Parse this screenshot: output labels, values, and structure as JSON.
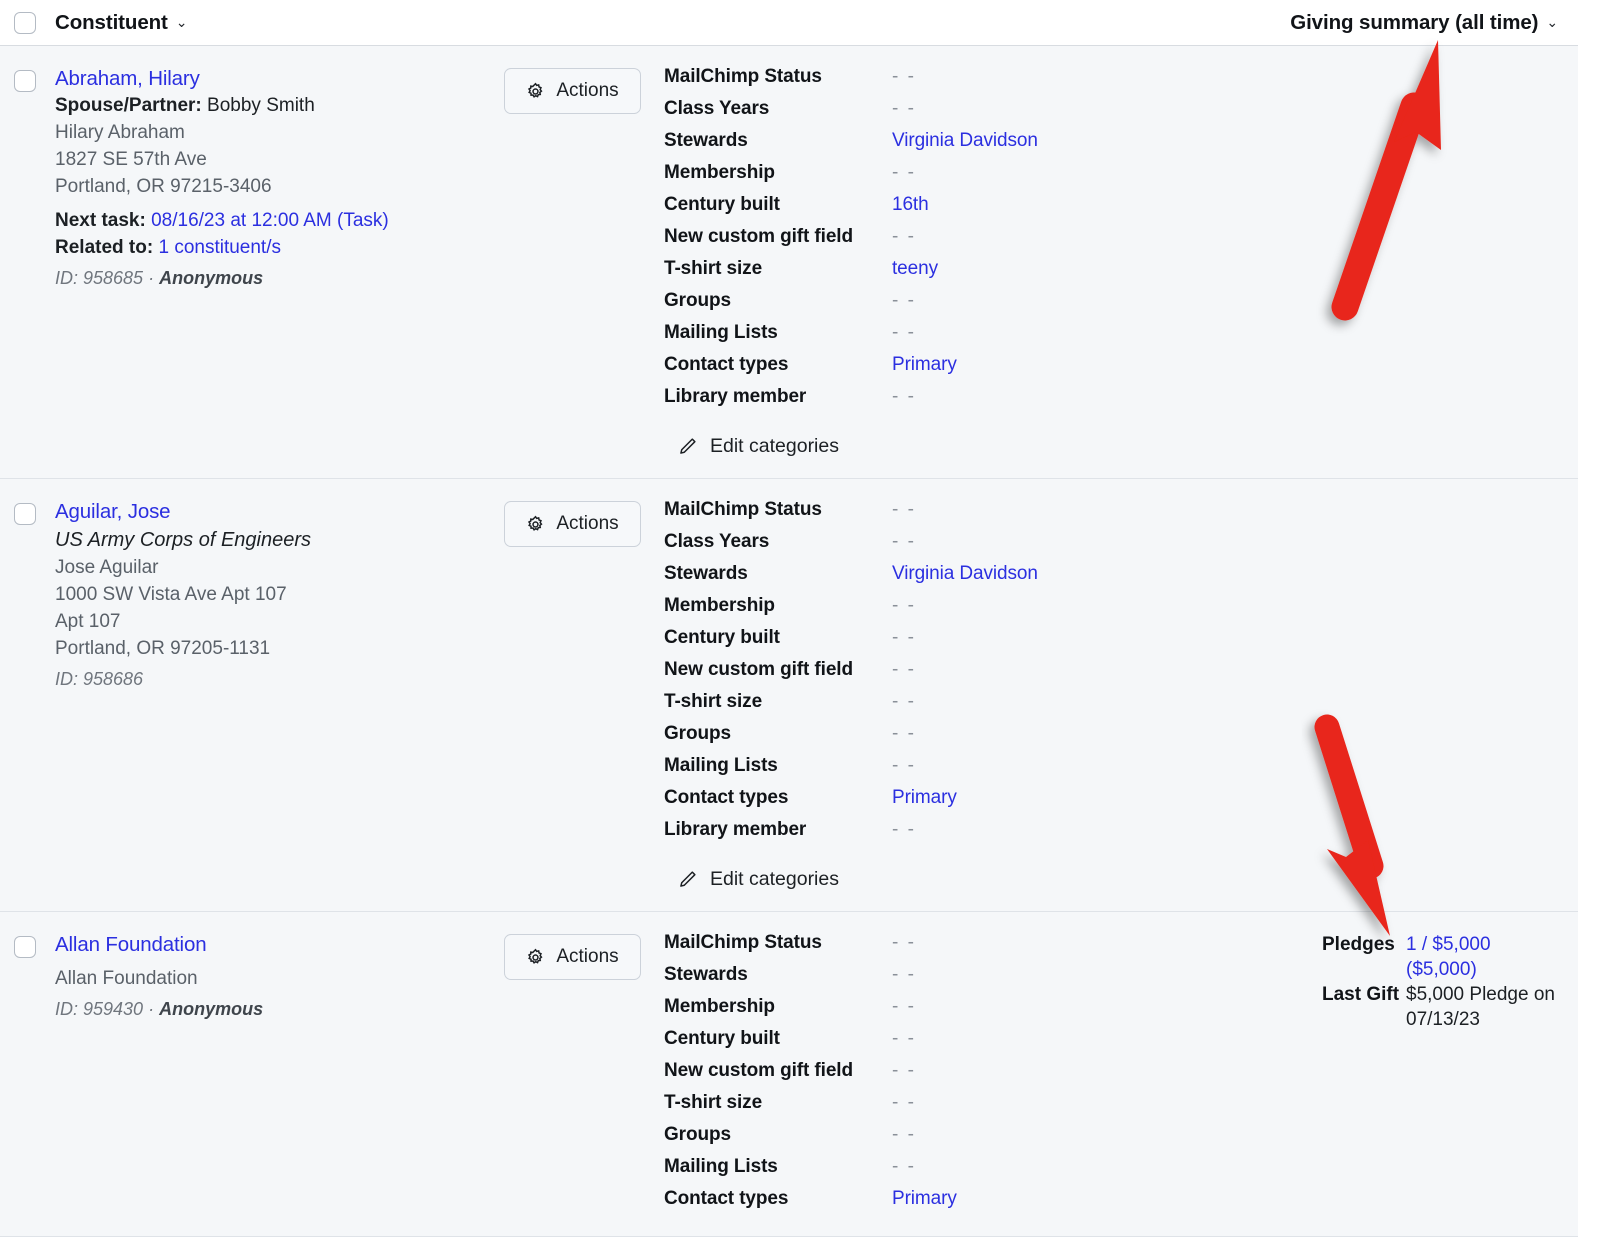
{
  "header": {
    "title": "Constituent",
    "caret_icon": "chevron-down-icon",
    "giving_summary_label": "Giving summary (all time)",
    "giving_summary_caret_icon": "chevron-down-icon"
  },
  "common": {
    "actions_label": "Actions",
    "actions_icon": "gear-icon",
    "edit_categories_label": "Edit categories",
    "edit_categories_icon": "pencil-icon",
    "empty_value": "- -",
    "checkbox_icon": "checkbox-unchecked-icon"
  },
  "colors": {
    "link": "#2b2fe0",
    "text": "#1c2024",
    "muted": "#70767e",
    "row_background": "#f5f7f9",
    "annotation_red": "#e8261a"
  },
  "rows": [
    {
      "name": "Abraham, Hilary",
      "org": "",
      "spouse_label": "Spouse/Partner:",
      "spouse_value": "Bobby Smith",
      "address": [
        "Hilary Abraham",
        "1827 SE 57th Ave",
        "Portland, OR 97215-3406"
      ],
      "next_task_label": "Next task:",
      "next_task_value": "08/16/23 at 12:00 AM (Task)",
      "related_to_label": "Related to:",
      "related_to_value": "1 constituent/s",
      "id_text": "ID: 958685 ·",
      "anonymous": "Anonymous",
      "fields": [
        {
          "label": "MailChimp Status",
          "value": "- -",
          "empty": true
        },
        {
          "label": "Class Years",
          "value": "- -",
          "empty": true
        },
        {
          "label": "Stewards",
          "value": "Virginia Davidson",
          "empty": false
        },
        {
          "label": "Membership",
          "value": "- -",
          "empty": true
        },
        {
          "label": "Century built",
          "value": "16th",
          "empty": false
        },
        {
          "label": "New custom gift field",
          "value": "- -",
          "empty": true
        },
        {
          "label": "T-shirt size",
          "value": "teeny",
          "empty": false
        },
        {
          "label": "Groups",
          "value": "- -",
          "empty": true
        },
        {
          "label": "Mailing Lists",
          "value": "- -",
          "empty": true
        },
        {
          "label": "Contact types",
          "value": "Primary",
          "empty": false
        },
        {
          "label": "Library member",
          "value": "- -",
          "empty": true
        }
      ],
      "giving": []
    },
    {
      "name": "Aguilar, Jose",
      "org": "US Army Corps of Engineers",
      "spouse_label": "",
      "spouse_value": "",
      "address": [
        "Jose Aguilar",
        "1000 SW Vista Ave Apt 107",
        "Apt 107",
        "Portland, OR 97205-1131"
      ],
      "next_task_label": "",
      "next_task_value": "",
      "related_to_label": "",
      "related_to_value": "",
      "id_text": "ID: 958686",
      "anonymous": "",
      "fields": [
        {
          "label": "MailChimp Status",
          "value": "- -",
          "empty": true
        },
        {
          "label": "Class Years",
          "value": "- -",
          "empty": true
        },
        {
          "label": "Stewards",
          "value": "Virginia Davidson",
          "empty": false
        },
        {
          "label": "Membership",
          "value": "- -",
          "empty": true
        },
        {
          "label": "Century built",
          "value": "- -",
          "empty": true
        },
        {
          "label": "New custom gift field",
          "value": "- -",
          "empty": true
        },
        {
          "label": "T-shirt size",
          "value": "- -",
          "empty": true
        },
        {
          "label": "Groups",
          "value": "- -",
          "empty": true
        },
        {
          "label": "Mailing Lists",
          "value": "- -",
          "empty": true
        },
        {
          "label": "Contact types",
          "value": "Primary",
          "empty": false
        },
        {
          "label": "Library member",
          "value": "- -",
          "empty": true
        }
      ],
      "giving": []
    },
    {
      "name": "Allan Foundation",
      "org": "",
      "spouse_label": "",
      "spouse_value": "",
      "address": [
        "Allan Foundation"
      ],
      "next_task_label": "",
      "next_task_value": "",
      "related_to_label": "",
      "related_to_value": "",
      "id_text": "ID: 959430 ·",
      "anonymous": "Anonymous",
      "fields": [
        {
          "label": "MailChimp Status",
          "value": "- -",
          "empty": true
        },
        {
          "label": "Stewards",
          "value": "- -",
          "empty": true
        },
        {
          "label": "Membership",
          "value": "- -",
          "empty": true
        },
        {
          "label": "Century built",
          "value": "- -",
          "empty": true
        },
        {
          "label": "New custom gift field",
          "value": "- -",
          "empty": true
        },
        {
          "label": "T-shirt size",
          "value": "- -",
          "empty": true
        },
        {
          "label": "Groups",
          "value": "- -",
          "empty": true
        },
        {
          "label": "Mailing Lists",
          "value": "- -",
          "empty": true
        },
        {
          "label": "Contact types",
          "value": "Primary",
          "empty": false
        }
      ],
      "giving": [
        {
          "label": "Pledges",
          "value": "1 / $5,000 ($5,000)",
          "link": true
        },
        {
          "label": "Last Gift",
          "value": "$5,000 Pledge on 07/13/23",
          "link": false
        }
      ]
    }
  ],
  "annotations": [
    {
      "name": "arrow-to-giving-summary-header",
      "direction": "up-right"
    },
    {
      "name": "arrow-to-pledges-value",
      "direction": "down-right"
    }
  ]
}
